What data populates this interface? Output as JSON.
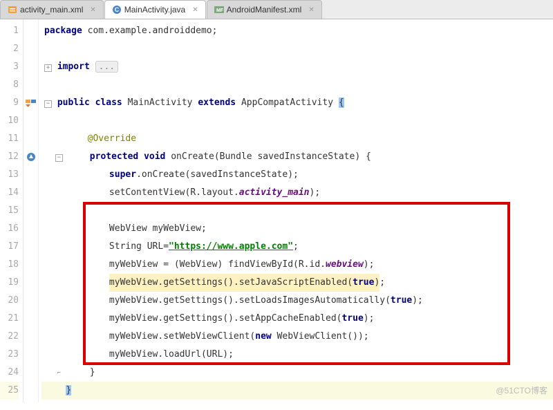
{
  "tabs": [
    {
      "label": "activity_main.xml",
      "active": false,
      "icon": "xml-file-icon"
    },
    {
      "label": "MainActivity.java",
      "active": true,
      "icon": "java-class-icon"
    },
    {
      "label": "AndroidManifest.xml",
      "active": false,
      "icon": "manifest-file-icon"
    }
  ],
  "line_numbers": [
    "1",
    "2",
    "3",
    "8",
    "9",
    "10",
    "11",
    "12",
    "13",
    "14",
    "15",
    "16",
    "17",
    "18",
    "19",
    "20",
    "21",
    "22",
    "23",
    "24",
    "25"
  ],
  "code": {
    "l1_package": "package",
    "l1_rest": " com.example.androiddemo;",
    "l3_import": "import",
    "l3_dots": "...",
    "l9_public": "public",
    "l9_class": " class",
    "l9_name": " MainActivity ",
    "l9_extends": "extends",
    "l9_super": " AppCompatActivity ",
    "l9_brace": "{",
    "l11_anno": "@Override",
    "l12_protected": "protected",
    "l12_void": " void",
    "l12_sig": " onCreate(Bundle savedInstanceState) {",
    "l13_super": "super",
    "l13_rest": ".onCreate(savedInstanceState);",
    "l14_a": "setContentView(R.layout.",
    "l14_b": "activity_main",
    "l14_c": ");",
    "l16": "WebView myWebView;",
    "l17_a": "String URL=",
    "l17_q1": "\"",
    "l17_url": "https://www.apple.com",
    "l17_q2": "\"",
    "l17_c": ";",
    "l18_a": "myWebView = (WebView) findViewById(R.id.",
    "l18_b": "webview",
    "l18_c": ");",
    "l19_a": "myWebView.getSettings().setJavaScriptEnabled(",
    "l19_b": "true",
    "l19_c": ")",
    "l19_d": ";",
    "l20_a": "myWebView.getSettings().setLoadsImagesAutomatically(",
    "l20_b": "true",
    "l20_c": ");",
    "l21_a": "myWebView.getSettings().setAppCacheEnabled(",
    "l21_b": "true",
    "l21_c": ");",
    "l22_a": "myWebView.setWebViewClient(",
    "l22_b": "new",
    "l22_c": " WebViewClient());",
    "l23": "myWebView.loadUrl(URL);",
    "l24": "}",
    "l25": "}"
  },
  "watermark": "@51CTO博客"
}
